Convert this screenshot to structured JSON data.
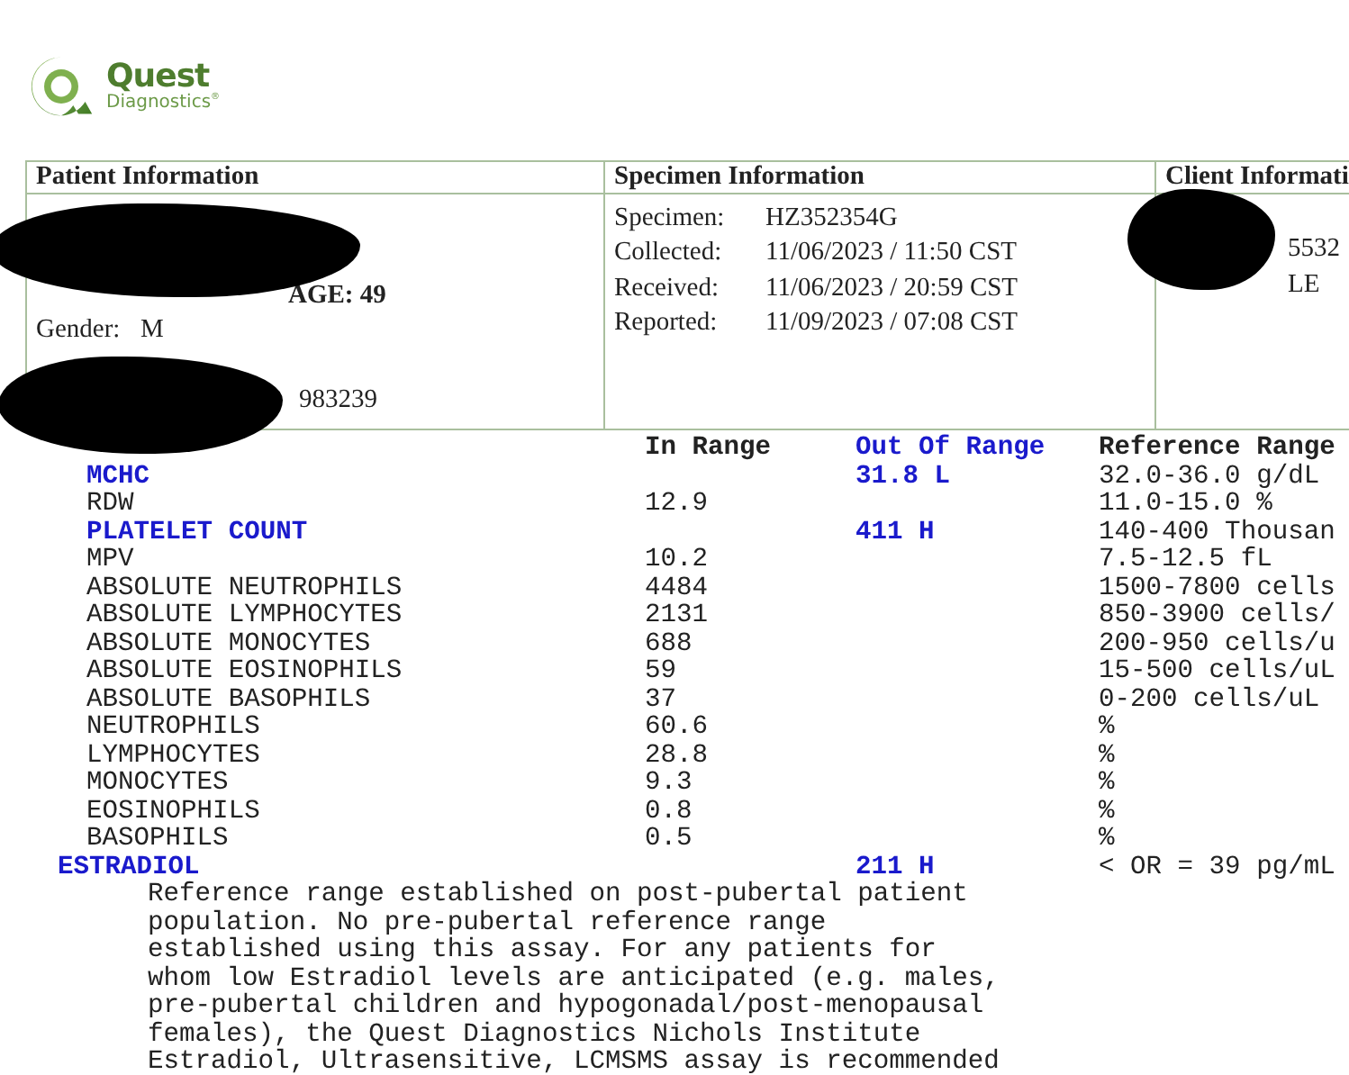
{
  "logo": {
    "name": "Quest",
    "subtitle": "Diagnostics",
    "mark": "®"
  },
  "info_table": {
    "headers": [
      "Patient Information",
      "Specimen Information",
      "Client Informati"
    ],
    "patient": {
      "age": "AGE: 49",
      "gender_label": "Gender:",
      "gender": "M",
      "id_fragment": "983239"
    },
    "specimen": [
      {
        "label": "Specimen:",
        "value": "HZ352354G"
      },
      {
        "label": "Collected:",
        "value": "11/06/2023  / 11:50 CST"
      },
      {
        "label": "Received:",
        "value": "11/06/2023  / 20:59 CST"
      },
      {
        "label": "Reported:",
        "value": "11/09/2023  / 07:08 CST"
      }
    ],
    "client": [
      "5532",
      "LE"
    ]
  },
  "results": {
    "columns": [
      "In Range",
      "Out Of Range",
      "Reference Range"
    ],
    "rows": [
      {
        "test": "MCHC",
        "result": "31.8 L",
        "out_of_range": true,
        "kind": "sub",
        "reference": "32.0-36.0 g/dL"
      },
      {
        "test": "RDW",
        "result": "12.9",
        "out_of_range": false,
        "kind": "sub",
        "reference": "11.0-15.0 %"
      },
      {
        "test": "PLATELET COUNT",
        "result": "411 H",
        "out_of_range": true,
        "kind": "sub",
        "reference": "140-400 Thousan"
      },
      {
        "test": "MPV",
        "result": "10.2",
        "out_of_range": false,
        "kind": "sub",
        "reference": "7.5-12.5 fL"
      },
      {
        "test": "ABSOLUTE NEUTROPHILS",
        "result": "4484",
        "out_of_range": false,
        "kind": "sub",
        "reference": "1500-7800 cells"
      },
      {
        "test": "ABSOLUTE LYMPHOCYTES",
        "result": "2131",
        "out_of_range": false,
        "kind": "sub",
        "reference": "850-3900 cells/"
      },
      {
        "test": "ABSOLUTE MONOCYTES",
        "result": "688",
        "out_of_range": false,
        "kind": "sub",
        "reference": "200-950 cells/u"
      },
      {
        "test": "ABSOLUTE EOSINOPHILS",
        "result": "59",
        "out_of_range": false,
        "kind": "sub",
        "reference": "15-500 cells/uL"
      },
      {
        "test": "ABSOLUTE BASOPHILS",
        "result": "37",
        "out_of_range": false,
        "kind": "sub",
        "reference": "0-200 cells/uL"
      },
      {
        "test": "NEUTROPHILS",
        "result": "60.6",
        "out_of_range": false,
        "kind": "sub",
        "reference": "%"
      },
      {
        "test": "LYMPHOCYTES",
        "result": "28.8",
        "out_of_range": false,
        "kind": "sub",
        "reference": "%"
      },
      {
        "test": "MONOCYTES",
        "result": "9.3",
        "out_of_range": false,
        "kind": "sub",
        "reference": "%"
      },
      {
        "test": "EOSINOPHILS",
        "result": "0.8",
        "out_of_range": false,
        "kind": "sub",
        "reference": "%"
      },
      {
        "test": "BASOPHILS",
        "result": "0.5",
        "out_of_range": false,
        "kind": "sub",
        "reference": "%"
      },
      {
        "test": "ESTRADIOL",
        "result": "211 H",
        "out_of_range": true,
        "kind": "top",
        "reference": "< OR = 39 pg/mL"
      }
    ],
    "comment": "Reference range established on post-pubertal patient\npopulation. No pre-pubertal reference range\nestablished using this assay. For any patients for\nwhom low Estradiol levels are anticipated (e.g. males,\npre-pubertal children and hypogonadal/post-menopausal\nfemales), the Quest Diagnostics Nichols Institute\nEstradiol, Ultrasensitive, LCMSMS assay is recommended"
  }
}
